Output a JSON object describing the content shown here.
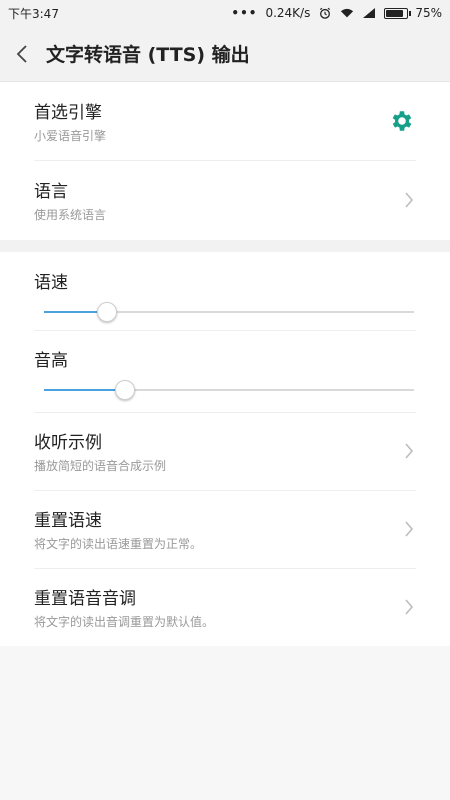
{
  "status": {
    "time": "下午3:47",
    "speed": "0.24K/s",
    "battery": "75%",
    "battery_level": 0.75
  },
  "header": {
    "title": "文字转语音 (TTS) 输出",
    "back_icon": "chevron-left-icon"
  },
  "engine": {
    "label": "首选引擎",
    "sub": "小爱语音引擎",
    "icon": "gear-icon",
    "accent": "#16a08a"
  },
  "language": {
    "label": "语言",
    "sub": "使用系统语言"
  },
  "speech_rate": {
    "label": "语速",
    "value": 0.17,
    "accent": "#4aa3df"
  },
  "pitch": {
    "label": "音高",
    "value": 0.22,
    "accent": "#4aa3df"
  },
  "sample": {
    "label": "收听示例",
    "sub": "播放简短的语音合成示例"
  },
  "reset_rate": {
    "label": "重置语速",
    "sub": "将文字的读出语速重置为正常。"
  },
  "reset_pitch": {
    "label": "重置语音音调",
    "sub": "将文字的读出音调重置为默认值。"
  }
}
